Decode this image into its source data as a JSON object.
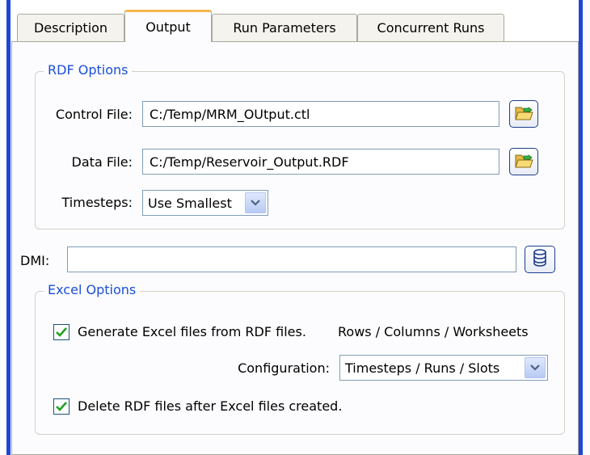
{
  "tabs": [
    {
      "label": "Description"
    },
    {
      "label": "Output"
    },
    {
      "label": "Run Parameters"
    },
    {
      "label": "Concurrent Runs"
    }
  ],
  "rdf_options": {
    "legend": "RDF Options",
    "control_file_label": "Control File:",
    "control_file_value": "C:/Temp/MRM_OUtput.ctl",
    "data_file_label": "Data File:",
    "data_file_value": "C:/Temp/Reservoir_Output.RDF",
    "timesteps_label": "Timesteps:",
    "timesteps_value": "Use Smallest"
  },
  "dmi": {
    "label": "DMI:",
    "value": ""
  },
  "excel_options": {
    "legend": "Excel Options",
    "generate_label": "Generate Excel files from RDF files.",
    "generate_checked": true,
    "layout_text": "Rows / Columns / Worksheets",
    "configuration_label": "Configuration:",
    "configuration_value": "Timesteps / Runs / Slots",
    "delete_label": "Delete RDF files after Excel files created.",
    "delete_checked": true
  },
  "colors": {
    "accent": "#1a4fd6",
    "active_tab_top": "#f4b84a",
    "window_border": "#1f46d6"
  },
  "icons": [
    "folder-open-icon",
    "database-icon",
    "chevron-down-icon",
    "checkmark-icon"
  ]
}
